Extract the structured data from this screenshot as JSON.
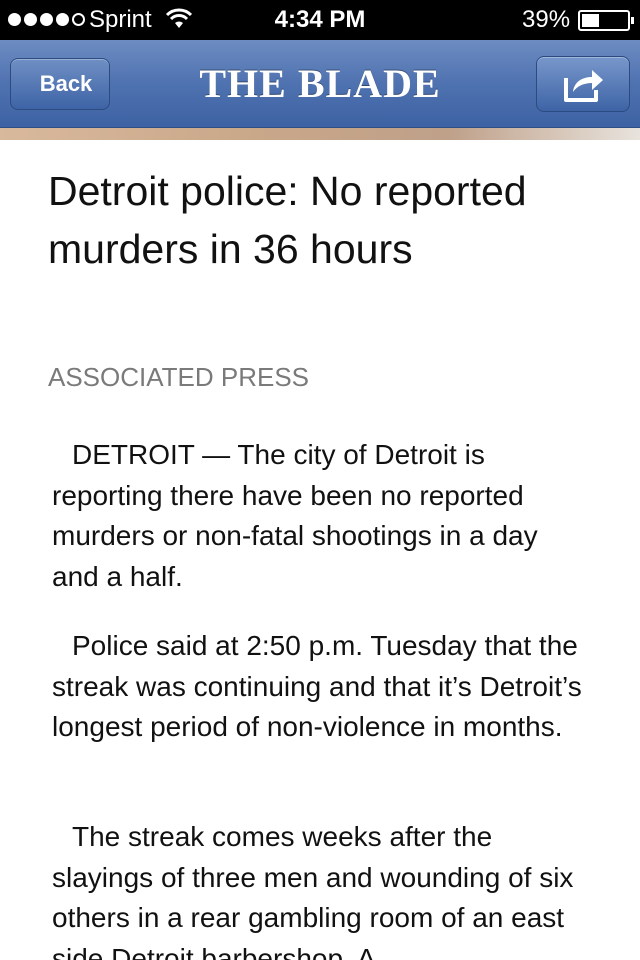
{
  "status_bar": {
    "carrier": "Sprint",
    "time": "4:34 PM",
    "battery_percent": "39%",
    "battery_level": 0.39,
    "signal_bars_filled": 4,
    "signal_bars_total": 5
  },
  "nav": {
    "back_label": "Back",
    "title": "THE BLADE",
    "share_icon": "share-icon"
  },
  "article": {
    "headline": "Detroit police: No reported murders in 36 hours",
    "byline": "ASSOCIATED PRESS",
    "paragraphs": [
      "DETROIT — The city of Detroit is reporting there have been no reported murders or non-fatal shootings in a day and a half.",
      "Police said at 2:50 p.m. Tuesday that the streak was continuing and that it’s Detroit’s longest period of non-violence in months.",
      "The streak comes weeks after the slayings of three men and wounding of six others in a rear gambling room of an east side Detroit barbershop. A"
    ]
  },
  "colors": {
    "nav_blue": "#4f72b0",
    "status_bar": "#000000",
    "byline_gray": "#7a7a7a"
  }
}
